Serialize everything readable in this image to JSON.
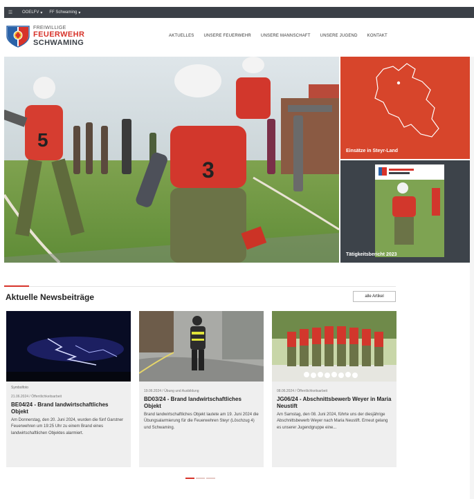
{
  "topbar": {
    "items": [
      "OOELFV",
      "FF Schwaming"
    ]
  },
  "logo": {
    "line1": "FREIWILLIGE",
    "line2": "FEUERWEHR",
    "line3": "SCHWAMING"
  },
  "nav": [
    "AKTUELLES",
    "UNSERE FEUERWEHR",
    "UNSERE MANNSCHAFT",
    "UNSERE JUGEND",
    "KONTAKT"
  ],
  "tiles": {
    "map_label": "Einsätze in Steyr-Land",
    "report_label": "Tätigkeitsbericht 2023"
  },
  "news": {
    "title": "Aktuelle Newsbeiträge",
    "all_button": "alle Artikel",
    "cards": [
      {
        "caption": "Symbolfoto",
        "meta": "21.06.2024 / Öffentlichkeitsarbeit",
        "title": "BE04/24 - Brand landwirtschaftliches Objekt",
        "text": "Am Donnerstag, den 20. Juni 2024, wurden die fünf Garstner Feuerwehren um 19:25 Uhr zu einem Brand eines landwirtschaftlichen Objektes alarmiert."
      },
      {
        "caption": "",
        "meta": "19.06.2024 / Übung und Ausbildung",
        "title": "BD03/24 - Brand landwirtschaftliches Objekt",
        "text": "Brand landwirtschaftliches Objekt lautete am 19. Juni 2024 die Übungsalarmierung für die Feuerwehren Steyr (Löschzug 4) und Schwaming."
      },
      {
        "caption": "",
        "meta": "08.06.2024 / Öffentlichkeitsarbeit",
        "title": "JG06/24 - Abschnittsbewerb Weyer in Maria Neustift",
        "text": "Am Samstag, den 08. Juni 2024, führte uns der diesjährige Abschnittsbewerb Weyer nach Maria Neustift. Erneut gelang es unserer Jugendgruppe eine..."
      }
    ]
  },
  "colors": {
    "brand_red": "#d7332a",
    "dark": "#3b4047",
    "card_bg": "#efefef"
  }
}
